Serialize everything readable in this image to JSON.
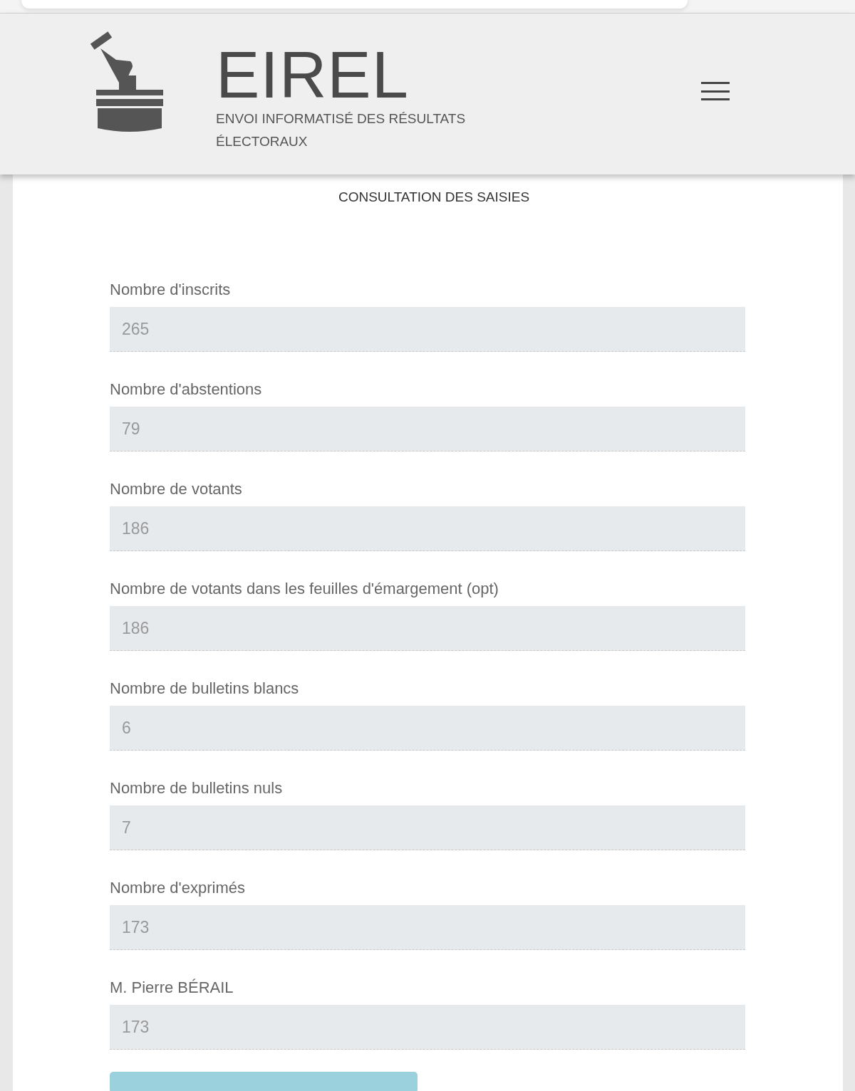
{
  "header": {
    "title": "EIREL",
    "subtitle": "ENVOI INFORMATISÉ DES RÉSULTATS ÉLECTORAUX"
  },
  "page_title": "CONSULTATION DES SAISIES",
  "fields": [
    {
      "label": "Nombre d'inscrits",
      "value": "265",
      "disabled": true
    },
    {
      "label": "Nombre d'abstentions",
      "value": "79",
      "disabled": true
    },
    {
      "label": "Nombre de votants",
      "value": "186",
      "disabled": true
    },
    {
      "label": "Nombre de votants dans les feuilles d'émargement (opt)",
      "value": "186",
      "disabled": true
    },
    {
      "label": "Nombre de bulletins blancs",
      "value": "6",
      "disabled": true
    },
    {
      "label": "Nombre de bulletins nuls",
      "value": "7",
      "disabled": true
    },
    {
      "label": "Nombre d'exprimés",
      "value": "173",
      "disabled": true
    },
    {
      "label": "M. Pierre BÉRAIL",
      "value": "173",
      "disabled": true
    }
  ]
}
